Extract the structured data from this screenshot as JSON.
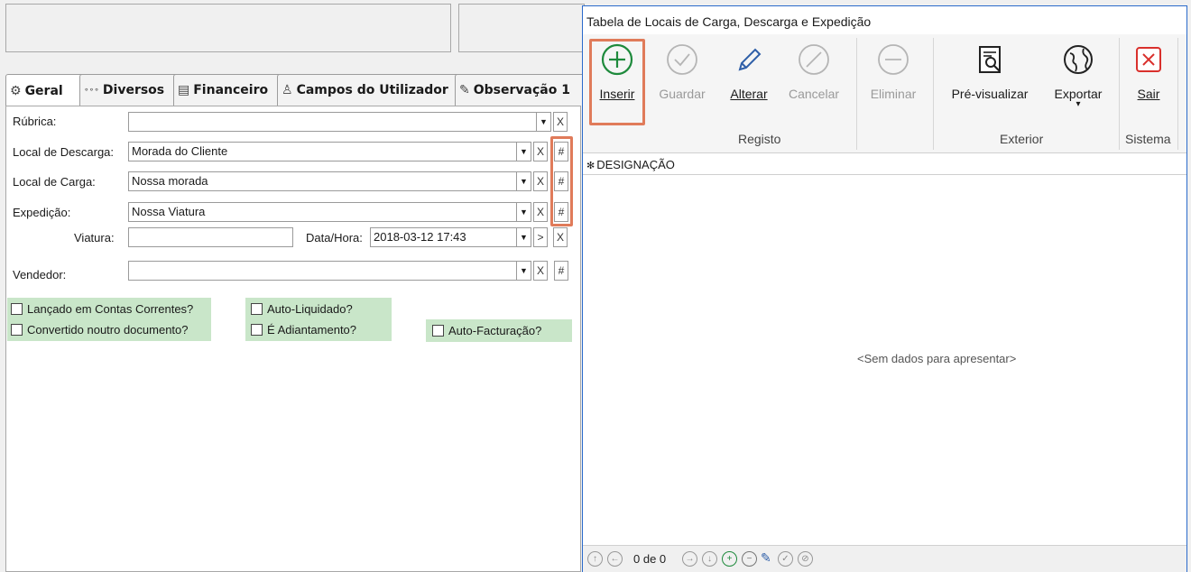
{
  "tabs": [
    {
      "label": "Geral",
      "icon": "gear-icon"
    },
    {
      "label": "Diversos",
      "icon": "dots-icon"
    },
    {
      "label": "Financeiro",
      "icon": "money-icon"
    },
    {
      "label": "Campos do Utilizador",
      "icon": "user-icon"
    },
    {
      "label": "Observação 1",
      "icon": "edit-note-icon"
    }
  ],
  "icon_glyphs": {
    "gear": "⚙",
    "dots": "∘∘∘",
    "money": "▤",
    "user": "♙",
    "note": "✎"
  },
  "form": {
    "rubrica_label": "Rúbrica:",
    "rubrica_value": "",
    "descarga_label": "Local de Descarga:",
    "descarga_value": "Morada do Cliente",
    "carga_label": "Local de Carga:",
    "carga_value": "Nossa morada",
    "expedicao_label": "Expedição:",
    "expedicao_value": "Nossa Viatura",
    "viatura_label": "Viatura:",
    "viatura_value": "",
    "datahora_label": "Data/Hora:",
    "datahora_value": "2018-03-12 17:43",
    "vendedor_label": "Vendedor:",
    "vendedor_value": "",
    "dropdown_glyph": "▼",
    "clear_glyph": "X",
    "hash_glyph": "#",
    "next_glyph": ">"
  },
  "checkboxes": {
    "contas": "Lançado em Contas Correntes?",
    "convertido": "Convertido noutro documento?",
    "auto_liquidado": "Auto-Liquidado?",
    "adiantamento": "É Adiantamento?",
    "auto_facturacao": "Auto-Facturação?"
  },
  "dialog": {
    "title": "Tabela de Locais de Carga, Descarga e Expedição",
    "buttons": {
      "inserir": "Inserir",
      "guardar": "Guardar",
      "alterar": "Alterar",
      "cancelar": "Cancelar",
      "eliminar": "Eliminar",
      "previsualizar": "Pré-visualizar",
      "exportar": "Exportar",
      "sair": "Sair"
    },
    "groups": {
      "registo": "Registo",
      "exterior": "Exterior",
      "sistema": "Sistema"
    },
    "grid_marker": "✻",
    "column_header": "DESIGNAÇÃO",
    "empty_text": "<Sem dados para apresentar>",
    "record_count": "0 de 0",
    "dropdown_arrow": "▾"
  },
  "colors": {
    "highlight": "#e07b5a",
    "green_add": "#1e8a3c",
    "close_red": "#d9302c",
    "checkbox_zone": "#c9e6c9"
  }
}
